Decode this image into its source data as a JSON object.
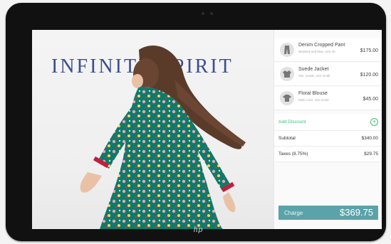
{
  "hero": {
    "title": "INFINITE SPIRIT"
  },
  "order": {
    "items": [
      {
        "name": "Denim Cropped Pant",
        "description": "Washed and blue, size 26",
        "price": "$175.00",
        "icon": "pants-icon"
      },
      {
        "name": "Suede Jacket",
        "description": "Tan, suede, size small",
        "price": "$120.00",
        "icon": "jacket-icon"
      },
      {
        "name": "Floral Blouse",
        "description": "Multi color, size small",
        "price": "$45.00",
        "icon": "blouse-icon"
      }
    ],
    "discount_label": "Add Discount",
    "discount_icon": "plus-circle-icon",
    "subtotal_label": "Subtotal",
    "subtotal_value": "$340.00",
    "taxes_label": "Taxes (8.75%)",
    "taxes_value": "$29.75",
    "charge_label": "Charge",
    "charge_total": "$369.75"
  },
  "device": {
    "brand_mark": "hp"
  },
  "colors": {
    "accent_green": "#3cbf7a",
    "charge_teal": "#5ba3a9",
    "title_blue": "#3a4f8f",
    "dress_green": "#0f7a6a"
  }
}
